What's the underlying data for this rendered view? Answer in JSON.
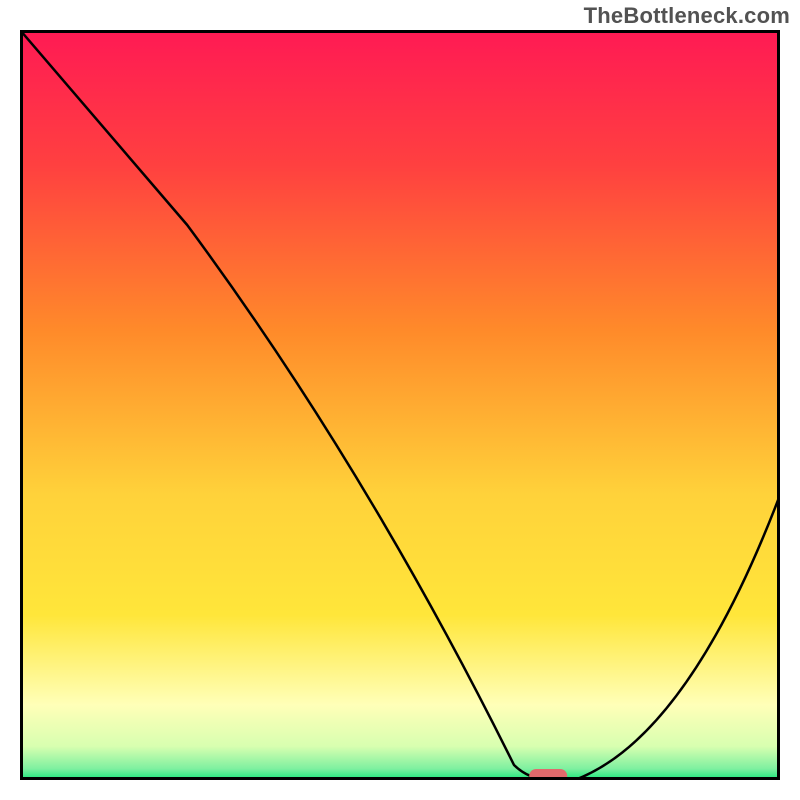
{
  "attribution": "TheBottleneck.com",
  "chart_data": {
    "type": "line",
    "title": "",
    "xlabel": "",
    "ylabel": "",
    "xlim": [
      0,
      100
    ],
    "ylim": [
      0,
      100
    ],
    "grid": false,
    "series": [
      {
        "name": "curve",
        "x": [
          0,
          22,
          65,
          70,
          73,
          100
        ],
        "values": [
          100,
          74,
          2,
          0,
          0,
          38
        ]
      }
    ],
    "marker": {
      "x1": 67,
      "x2": 72,
      "y": 0,
      "color": "#e06a6c"
    },
    "gradient_colors": {
      "top": "#ff1a54",
      "mid_upper": "#ff8a2a",
      "mid": "#ffe63a",
      "pale": "#ffffb8",
      "bottom": "#17e67a"
    },
    "axis_color": "#000000",
    "line_color": "#000000"
  }
}
